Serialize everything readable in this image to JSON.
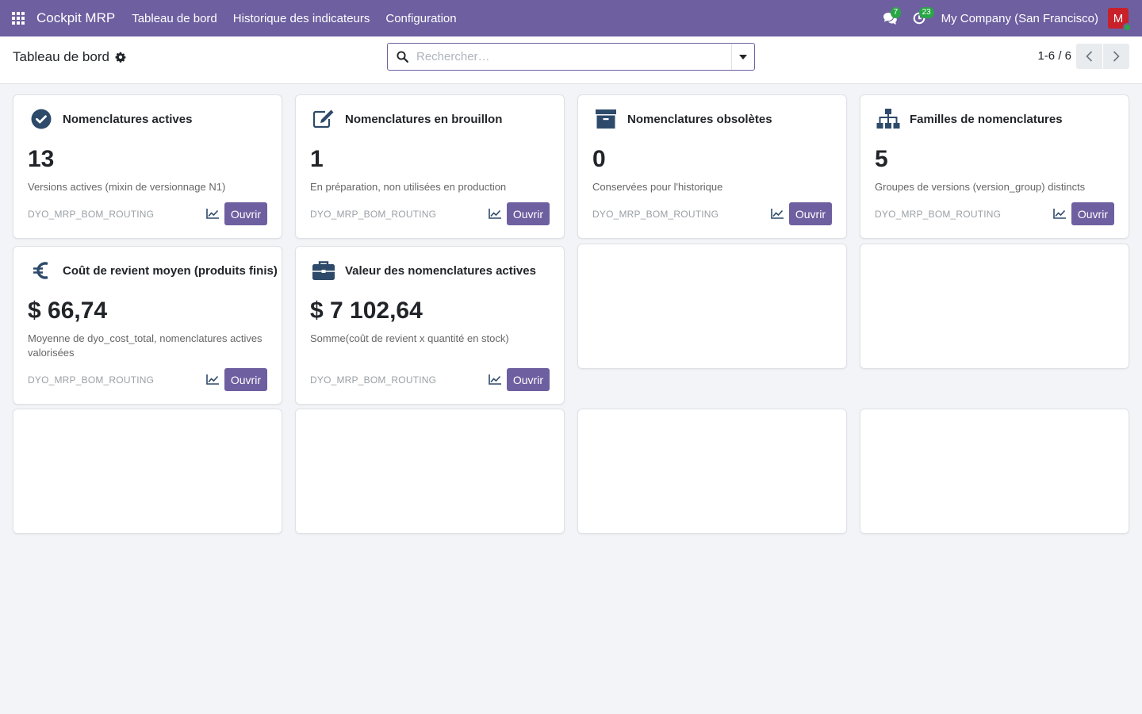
{
  "navbar": {
    "app_name": "Cockpit MRP",
    "menus": [
      "Tableau de bord",
      "Historique des indicateurs",
      "Configuration"
    ],
    "messages_count": "7",
    "activities_count": "23",
    "company": "My Company (San Francisco)",
    "avatar_initial": "M"
  },
  "control_panel": {
    "title": "Tableau de bord",
    "search_placeholder": "Rechercher…",
    "pager": "1-6 / 6"
  },
  "cards": [
    {
      "icon": "check-circle-icon",
      "title": "Nomenclatures actives",
      "value": "13",
      "description": "Versions actives (mixin de versionnage N1)",
      "model": "DYO_MRP_BOM_ROUTING",
      "button": "Ouvrir"
    },
    {
      "icon": "edit-icon",
      "title": "Nomenclatures en brouillon",
      "value": "1",
      "description": "En préparation, non utilisées en production",
      "model": "DYO_MRP_BOM_ROUTING",
      "button": "Ouvrir"
    },
    {
      "icon": "archive-icon",
      "title": "Nomenclatures obsolètes",
      "value": "0",
      "description": "Conservées pour l'historique",
      "model": "DYO_MRP_BOM_ROUTING",
      "button": "Ouvrir"
    },
    {
      "icon": "sitemap-icon",
      "title": "Familles de nomenclatures",
      "value": "5",
      "description": "Groupes de versions (version_group) distincts",
      "model": "DYO_MRP_BOM_ROUTING",
      "button": "Ouvrir"
    },
    {
      "icon": "euro-icon",
      "title": "Coût de revient moyen (produits finis)",
      "value": "$ 66,74",
      "description": "Moyenne de dyo_cost_total, nomenclatures actives valorisées",
      "model": "DYO_MRP_BOM_ROUTING",
      "button": "Ouvrir"
    },
    {
      "icon": "briefcase-icon",
      "title": "Valeur des nomenclatures actives",
      "value": "$ 7 102,64",
      "description": "Somme(coût de revient x quantité en stock)",
      "model": "DYO_MRP_BOM_ROUTING",
      "button": "Ouvrir"
    }
  ],
  "colors": {
    "primary": "#6e5fa0",
    "icon": "#2d4a6a",
    "badge": "#28a745",
    "avatar": "#c8212a"
  }
}
